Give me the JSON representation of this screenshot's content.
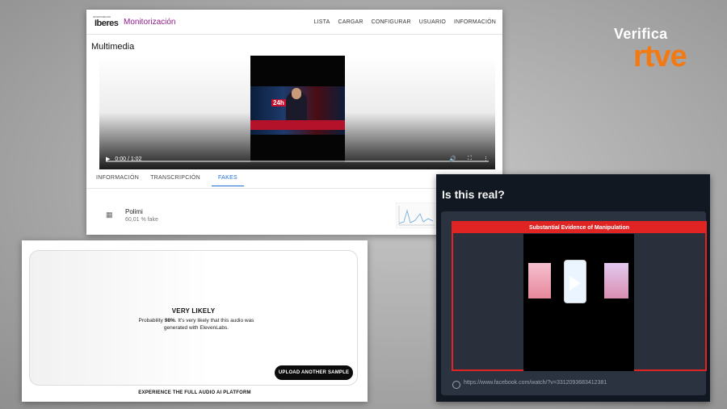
{
  "monitor": {
    "logo_small": "observatorio",
    "logo_main": "Iberes",
    "app_title": "Monitorización",
    "nav": [
      "LISTA",
      "CARGAR",
      "CONFIGURAR",
      "USUARIO",
      "INFORMACIÓN"
    ],
    "section_title": "Multimedia",
    "video": {
      "time": "0:00 / 1:02",
      "badge": "24h",
      "progress": 0.0
    },
    "tabs": [
      "INFORMACIÓN",
      "TRANSCRIPCIÓN",
      "FAKES"
    ],
    "active_tab": "FAKES",
    "fake": {
      "name": "Polimi",
      "percent": "60,01 % fake"
    }
  },
  "brand": {
    "line1": "Verifica",
    "line2": "rtve",
    "color": "#f37a13"
  },
  "audio": {
    "verdict": "VERY LIKELY",
    "probability_label": "Probability",
    "probability_value": "98%",
    "description": ". It's very likely that this audio was generated with ElevenLabs.",
    "upload_label": "UPLOAD ANOTHER SAMPLE",
    "cta": "EXPERIENCE THE FULL AUDIO AI PLATFORM"
  },
  "real": {
    "question": "Is this real?",
    "result_title": "Substantial Evidence of Manipulation",
    "link": "https://www.facebook.com/watch/?v=3312093683412381",
    "accent": "#e02424"
  }
}
